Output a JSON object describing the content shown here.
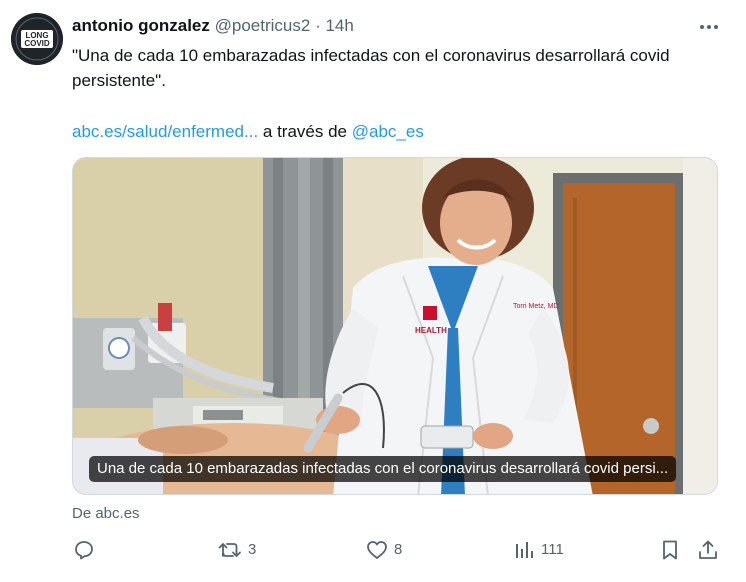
{
  "tweet": {
    "avatar_text": [
      "LONG",
      "COVID"
    ],
    "author_name": "antonio gonzalez",
    "author_handle": "@poetricus2",
    "separator": "·",
    "time": "14h",
    "text": "\"Una de cada 10 embarazadas infectadas con el coronavirus desarrollará covid persistente\".",
    "link_text": "abc.es/salud/enfermed...",
    "via_text": "a través de",
    "via_handle": "@abc_es"
  },
  "card": {
    "caption": "Una de cada 10 embarazadas infectadas con el coronavirus desarrollará covid persi...",
    "badge_text": "Torri Metz, MD",
    "logo_text": "HEALTH"
  },
  "source": "De abc.es",
  "actions": {
    "reply_count": "",
    "retweet_count": "3",
    "like_count": "8",
    "views_count": "111"
  },
  "colors": {
    "text_primary": "#0f1419",
    "text_secondary": "#536471",
    "link": "#1d9bf0"
  }
}
